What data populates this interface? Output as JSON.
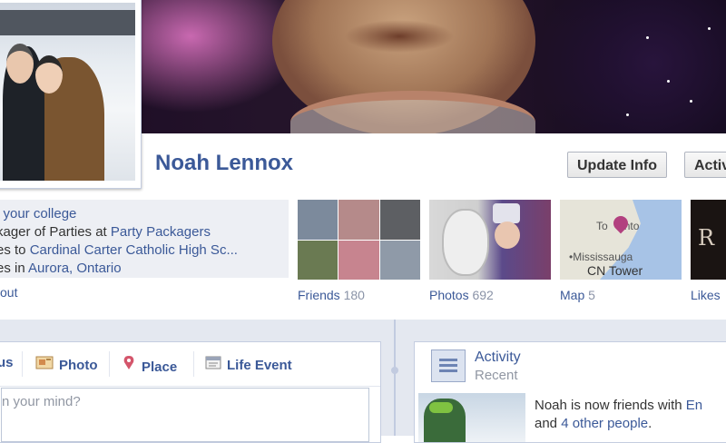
{
  "profile": {
    "name": "Noah Lennox"
  },
  "buttons": {
    "update_info": "Update Info",
    "activity": "Activ"
  },
  "info": {
    "line1": {
      "text": "l your college"
    },
    "line2": {
      "prefix": "kager of Parties at ",
      "link": "Party Packagers"
    },
    "line3": {
      "prefix": "es to ",
      "link": "Cardinal Carter Catholic High Sc..."
    },
    "line4": {
      "prefix": "es in ",
      "link": "Aurora, Ontario"
    },
    "about": "out"
  },
  "tiles": {
    "friends": {
      "label": "Friends",
      "count": "180"
    },
    "photos": {
      "label": "Photos",
      "count": "692"
    },
    "map": {
      "label": "Map",
      "count": "5",
      "city": "Toronto",
      "city_part1": "To",
      "city_part2": "nto",
      "area": "•Mississauga",
      "landmark": "CN Tower"
    },
    "likes": {
      "label": "Likes"
    }
  },
  "composer": {
    "tabs": [
      {
        "label": "us",
        "icon": "status-icon"
      },
      {
        "label": "Photo",
        "icon": "photo-icon"
      },
      {
        "label": "Place",
        "icon": "place-icon"
      },
      {
        "label": "Life Event",
        "icon": "life-event-icon"
      }
    ],
    "placeholder": "n your mind?"
  },
  "activity": {
    "title": "Activity",
    "subtitle": "Recent",
    "text_prefix": "Noah is now friends with ",
    "text_link1": "En",
    "text_mid": "and ",
    "text_link2": "4 other people",
    "text_end": "."
  },
  "colors": {
    "brand": "#3b5998",
    "muted": "#8a93a7"
  }
}
